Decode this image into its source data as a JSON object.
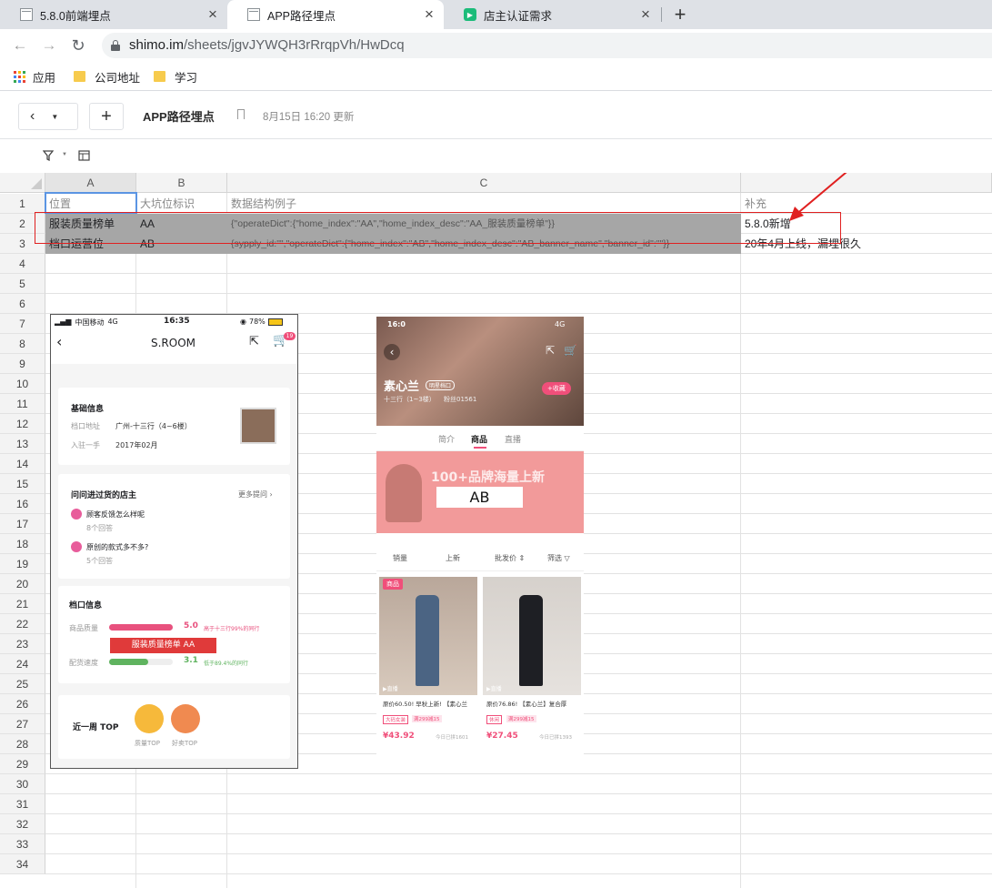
{
  "browser": {
    "tabs": [
      {
        "title": "5.8.0前端埋点",
        "favicon": "sheet-icon"
      },
      {
        "title": "APP路径埋点",
        "favicon": "sheet-icon",
        "active": true
      },
      {
        "title": "店主认证需求",
        "favicon": "play-icon"
      }
    ],
    "new_tab": "+",
    "url_host": "shimo.im",
    "url_path": "/sheets/jgvJYWQH3rRrqpVh/HwDcq",
    "bookmarks": [
      "应用",
      "公司地址",
      "学习"
    ]
  },
  "doc": {
    "title": "APP路径埋点",
    "updated": "8月15日 16:20 更新"
  },
  "sheet": {
    "columns": [
      "A",
      "B",
      "C"
    ],
    "row_numbers": [
      "1",
      "2",
      "3",
      "4",
      "5",
      "6",
      "7",
      "8",
      "9",
      "10",
      "11",
      "12",
      "13",
      "14",
      "15",
      "16",
      "17",
      "18",
      "19",
      "20",
      "21",
      "22",
      "23",
      "24",
      "25",
      "26",
      "27",
      "28",
      "29",
      "30",
      "31",
      "32",
      "33",
      "34"
    ],
    "header_row": {
      "a": "位置",
      "b": "大坑位标识",
      "c": "数据结构例子",
      "d": "补充"
    },
    "rows": [
      {
        "a": "服装质量榜单",
        "b": "AA",
        "c": "{\"operateDict\":{\"home_index\":\"AA\",\"home_index_desc\":\"AA_服装质量榜单\"}}",
        "d": "5.8.0新增"
      },
      {
        "a": "档口运营位",
        "b": "AB",
        "c": "{sypply_id:\"\",\"operateDict\":{\"home_index\":\"AB\",\"home_index_desc\":\"AB_banner_name\",\"banner_id\":\"\"}}",
        "d": "20年4月上线，漏埋很久"
      }
    ]
  },
  "phone1": {
    "carrier": "中国移动",
    "network": "4G",
    "time": "16:35",
    "battery": "78%",
    "title": "S.ROOM",
    "cart_badge": "19",
    "basic_info_title": "基础信息",
    "addr_label": "档口地址",
    "addr_value": "广州-十三行（4~6楼）",
    "join_label": "入驻一手",
    "join_value": "2017年02月",
    "qa_title": "问问进过货的店主",
    "qa_more": "更多提问 ›",
    "q1": "顾客反馈怎么样呢",
    "q1_count": "8个回答",
    "q2": "原创的款式多不多?",
    "q2_count": "5个回答",
    "stall_title": "档口信息",
    "quality_label": "商品质量",
    "quality_score": "5.0",
    "quality_note": "高于十三行99%的同行",
    "overlay_label": "服装质量榜单 AA",
    "delivery_label": "配货速度",
    "delivery_score": "3.1",
    "delivery_note": "低于89.4%的同行",
    "top_title": "近一周 TOP",
    "top1": "质量TOP",
    "top2": "好卖TOP",
    "quality_fill": 1.0,
    "delivery_fill": 0.62
  },
  "phone2": {
    "time": "16:0",
    "network": "4G",
    "shop_name": "素心兰",
    "shop_badge": "明星档口",
    "shop_sub": "十三行（1~3楼）",
    "fans": "粉丝01561",
    "fav_button": "+收藏",
    "tabs": [
      "简介",
      "商品",
      "直播"
    ],
    "banner_text": "100+品牌海量上新",
    "overlay_label": "AB",
    "filters": [
      "销量",
      "上新",
      "批发价 ⇕",
      "筛选 ▽"
    ],
    "products": [
      {
        "title": "原价60.50! 早秋上新! 【素心兰",
        "tag1": "大码女装",
        "tag2": "满299减15",
        "price": "¥43.92",
        "sold": "今日已拼1601",
        "live": "▶直播"
      },
      {
        "title": "原价76.86! 【素心兰】复合厚",
        "tag1": "休闲",
        "tag2": "满299减15",
        "price": "¥27.45",
        "sold": "今日已拼1393",
        "live": "▶直播"
      }
    ],
    "badge": "商品"
  },
  "colors": {
    "tab_bg": "#dee1e6",
    "highlight_row": "#a6a6a6",
    "annotation_red": "#e02020",
    "pink": "#f04f7a"
  }
}
